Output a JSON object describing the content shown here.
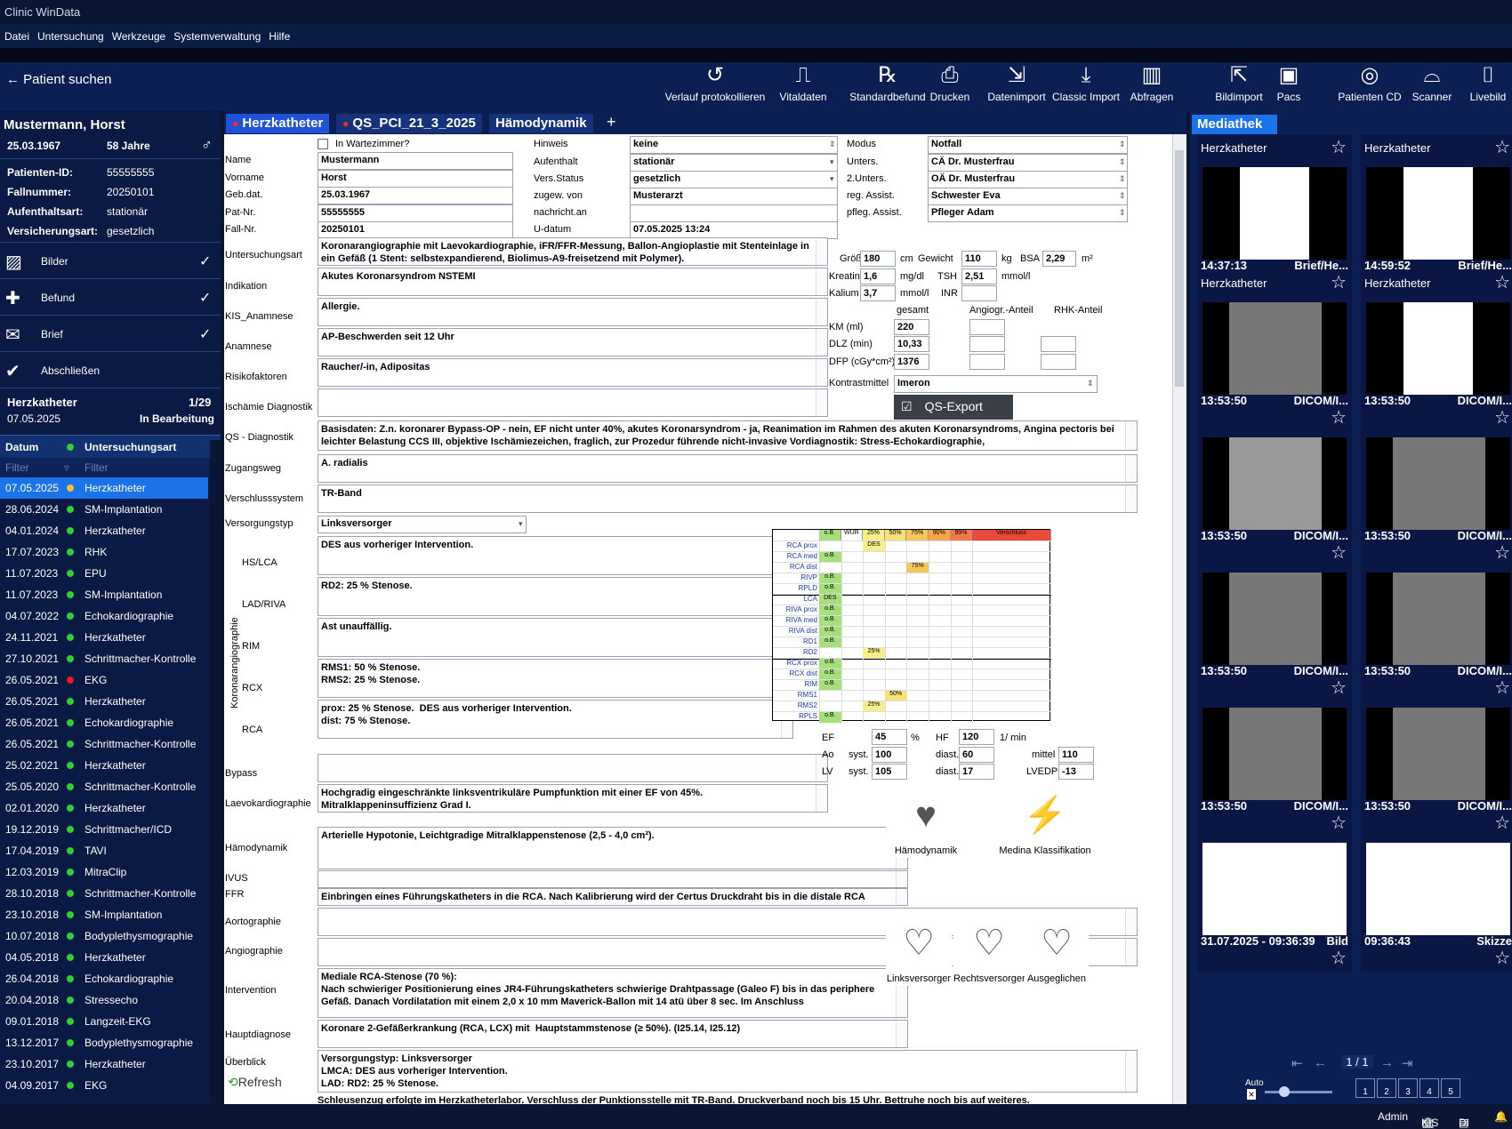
{
  "app": {
    "title": "Clinic WinData"
  },
  "menu": [
    "Datei",
    "Untersuchung",
    "Werkzeuge",
    "Systemverwaltung",
    "Hilfe"
  ],
  "toolbar": {
    "patient_search": "Patient suchen",
    "buttons": [
      "Verlauf protokollieren",
      "Vitaldaten",
      "Standardbefund",
      "Drucken",
      "Datenimport",
      "Classic Import",
      "Abfragen"
    ],
    "right_buttons": [
      "Bildimport",
      "Pacs",
      "Patienten CD",
      "Scanner",
      "Livebild"
    ]
  },
  "patient": {
    "name": "Mustermann, Horst",
    "dob": "25.03.1967",
    "age": "58 Jahre",
    "fields": [
      {
        "k": "Patienten-ID:",
        "v": "55555555"
      },
      {
        "k": "Fallnummer:",
        "v": "20250101"
      },
      {
        "k": "Aufenthaltsart:",
        "v": "stationär"
      },
      {
        "k": "Versicherungsart:",
        "v": "gesetzlich"
      }
    ]
  },
  "steps": [
    {
      "label": "Bilder",
      "icon": "image-icon",
      "done": "✓"
    },
    {
      "label": "Befund",
      "icon": "clipboard-plus-icon",
      "done": "✓"
    },
    {
      "label": "Brief",
      "icon": "envelope-icon",
      "done": "✓"
    },
    {
      "label": "Abschließen",
      "icon": "document-check-icon",
      "done": ""
    }
  ],
  "exam": {
    "name": "Herzkatheter",
    "count": "1/29",
    "date": "07.05.2025",
    "status": "In Bearbeitung"
  },
  "history": {
    "col_date": "Datum",
    "col_type": "Untersuchungsart",
    "filter": "Filter",
    "rows": [
      {
        "d": "07.05.2025",
        "t": "Herzkatheter",
        "c": "#f2c230"
      },
      {
        "d": "28.06.2024",
        "t": "SM-Implantation",
        "c": "#2fd02f"
      },
      {
        "d": "04.01.2024",
        "t": "Herzkatheter",
        "c": "#2fd02f"
      },
      {
        "d": "17.07.2023",
        "t": "RHK",
        "c": "#2fd02f"
      },
      {
        "d": "11.07.2023",
        "t": "EPU",
        "c": "#2fd02f"
      },
      {
        "d": "11.07.2023",
        "t": "SM-Implantation",
        "c": "#2fd02f"
      },
      {
        "d": "04.07.2022",
        "t": "Echokardiographie",
        "c": "#2fd02f"
      },
      {
        "d": "24.11.2021",
        "t": "Herzkatheter",
        "c": "#2fd02f"
      },
      {
        "d": "27.10.2021",
        "t": "Schrittmacher-Kontrolle",
        "c": "#2fd02f"
      },
      {
        "d": "26.05.2021",
        "t": "EKG",
        "c": "#e81c1c"
      },
      {
        "d": "26.05.2021",
        "t": "Herzkatheter",
        "c": "#2fd02f"
      },
      {
        "d": "26.05.2021",
        "t": "Echokardiographie",
        "c": "#2fd02f"
      },
      {
        "d": "26.05.2021",
        "t": "Schrittmacher-Kontrolle",
        "c": "#2fd02f"
      },
      {
        "d": "25.02.2021",
        "t": "Herzkatheter",
        "c": "#2fd02f"
      },
      {
        "d": "25.05.2020",
        "t": "Schrittmacher-Kontrolle",
        "c": "#2fd02f"
      },
      {
        "d": "02.01.2020",
        "t": "Herzkatheter",
        "c": "#2fd02f"
      },
      {
        "d": "19.12.2019",
        "t": "Schrittmacher/ICD",
        "c": "#2fd02f"
      },
      {
        "d": "17.04.2019",
        "t": "TAVI",
        "c": "#2fd02f"
      },
      {
        "d": "12.03.2019",
        "t": "MitraClip",
        "c": "#2fd02f"
      },
      {
        "d": "28.10.2018",
        "t": "Schrittmacher-Kontrolle",
        "c": "#2fd02f"
      },
      {
        "d": "23.10.2018",
        "t": "SM-Implantation",
        "c": "#2fd02f"
      },
      {
        "d": "10.07.2018",
        "t": "Bodyplethysmographie",
        "c": "#2fd02f"
      },
      {
        "d": "04.05.2018",
        "t": "Herzkatheter",
        "c": "#2fd02f"
      },
      {
        "d": "26.04.2018",
        "t": "Echokardiographie",
        "c": "#2fd02f"
      },
      {
        "d": "20.04.2018",
        "t": "Stressecho",
        "c": "#2fd02f"
      },
      {
        "d": "09.01.2018",
        "t": "Langzeit-EKG",
        "c": "#2fd02f"
      },
      {
        "d": "13.12.2017",
        "t": "Bodyplethysmographie",
        "c": "#2fd02f"
      },
      {
        "d": "23.10.2017",
        "t": "Herzkatheter",
        "c": "#2fd02f"
      },
      {
        "d": "04.09.2017",
        "t": "EKG",
        "c": "#2fd02f"
      }
    ]
  },
  "tabs": [
    "Herzkatheter",
    "QS_PCI_21_3_2025",
    "Hämodynamik",
    "+"
  ],
  "form": {
    "wartezimmer": "In Wartezimmer?",
    "name_l": "Name",
    "name": "Mustermann",
    "vorname_l": "Vorname",
    "vorname": "Horst",
    "gebdat_l": "Geb.dat.",
    "gebdat": "25.03.1967",
    "patnr_l": "Pat-Nr.",
    "patnr": "55555555",
    "fallnr_l": "Fall-Nr.",
    "fallnr": "20250101",
    "hinweis_l": "Hinweis",
    "hinweis": "keine",
    "aufenthalt_l": "Aufenthalt",
    "aufenthalt": "stationär",
    "versstatus_l": "Vers.Status",
    "versstatus": "gesetzlich",
    "zugew_l": "zugew. von",
    "zugew": "Musterarzt",
    "nachricht_l": "nachricht.an",
    "nachricht": "",
    "udatum_l": "U-datum",
    "udatum": "07.05.2025 13:24",
    "modus_l": "Modus",
    "modus": "Notfall",
    "unters_l": "Unters.",
    "unters": "CÄ Dr. Musterfrau",
    "unters2_l": "2.Unters.",
    "unters2": "OÄ Dr. Musterfrau",
    "regassist_l": "reg. Assist.",
    "regassist": "Schwester Eva",
    "flegassist_l": "pfleg. Assist.",
    "flegassist": "Pfleger Adam",
    "uart_l": "Untersuchungsart",
    "uart": "Koronarangiographie mit Laevokardiographie, iFR/FFR-Messung, Ballon-Angioplastie mit Stenteinlage in ein Gefäß (1 Stent: selbstexpandierend, Biolimus-A9-freisetzend mit Polymer).",
    "indikation_l": "Indikation",
    "indikation": "Akutes Koronarsyndrom NSTEMI",
    "kis_l": "KIS_Anamnese",
    "kis": "Allergie.",
    "anamnese_l": "Anamnese",
    "anamnese": "AP-Beschwerden seit 12 Uhr",
    "risiko_l": "Risikofaktoren",
    "risiko": "Raucher/-in, Adipositas",
    "ischaemie_l": "Ischämie Diagnostik",
    "ischaemie": "",
    "qsdiag_l": "QS - Diagnostik",
    "qsdiag": "Basisdaten: Z.n. koronarer Bypass-OP - nein, EF nicht unter 40%, akutes Koronarsyndrom - ja, Reanimation im Rahmen des akuten Koronarsyndroms, Angina pectoris bei leichter Belastung CCS III, objektive Ischämiezeichen, fraglich, zur Prozedur führende nicht-invasive Vordiagnostik: Stress-Echokardiographie,",
    "zugang_l": "Zugangsweg",
    "zugang": "A. radialis",
    "verschluss_l": "Verschlusssystem",
    "verschluss": "TR-Band",
    "versorgung_l": "Versorgungstyp",
    "versorgung": "Linksversorger",
    "koro_l": "Koronarangiographie",
    "hslca_l": "HS/LCA",
    "hslca": "DES aus vorheriger Intervention.",
    "lad_l": "LAD/RIVA",
    "lad": "RD2: 25 % Stenose.",
    "rim_l": "RIM",
    "rim": "Ast unauffällig.",
    "rcx_l": "RCX",
    "rcx": "RMS1: 50 % Stenose.\nRMS2: 25 % Stenose.",
    "rca_l": "RCA",
    "rca": "prox: 25 % Stenose.  DES aus vorheriger Intervention.\ndist: 75 % Stenose.",
    "bypass_l": "Bypass",
    "bypass": "",
    "laevo_l": "Laevokardiographie",
    "laevo": "Hochgradig eingeschränkte linksventrikuläre Pumpfunktion mit einer EF von 45%.\nMitralklappeninsuffizienz Grad I.",
    "haemo_l": "Hämodynamik",
    "haemo": "Arterielle Hypotonie, Leichtgradige Mitralklappenstenose (2,5 - 4,0 cm²).",
    "ivus_l": "IVUS",
    "ivus": "",
    "ffr_l": "FFR",
    "ffr": "Einbringen eines Führungskatheters in die RCA. Nach Kalibrierung wird der Certus Druckdraht bis in die distale RCA",
    "aorto_l": "Aortographie",
    "aorto": "",
    "angio_l": "Angiographie",
    "angio": "",
    "interv_l": "Intervention",
    "interv": "Mediale RCA-Stenose (70 %):\nNach schwieriger Positionierung eines JR4-Führungskatheters schwierige Drahtpassage (Galeo F) bis in das periphere Gefäß. Danach Vordilatation mit einem 2,0 x 10 mm Maverick-Ballon mit 14 atü über 8 sec. Im Anschluss",
    "haupt_l": "Hauptdiagnose",
    "haupt": "Koronare 2-Gefäßerkrankung (RCA, LCX) mit  Hauptstammstenose (≥ 50%). (I25.14, I25.12)",
    "ueber_l": "Überblick",
    "ueber": "Versorgungstyp: Linksversorger\nLMCA: DES aus vorheriger Intervention.\nLAD: RD2: 25 % Stenose.",
    "ueber_tail": "Schleusenzug erfolgte im Herzkatheterlabor. Verschluss der Punktionsstelle mit TR-Band. Druckverband noch bis 15 Uhr. Bettruhe noch bis auf weiteres.",
    "refresh": "Refresh",
    "groesse_l": "Größe",
    "groesse": "180",
    "groesse_u": "cm",
    "gewicht_l": "Gewicht",
    "gewicht": "110",
    "gewicht_u": "kg",
    "bsa_l": "BSA",
    "bsa": "2,29",
    "bsa_u": "m²",
    "kreatinin_l": "Kreatinin",
    "kreatinin": "1,6",
    "kreatinin_u": "mg/dl",
    "tsh_l": "TSH",
    "tsh": "2,51",
    "tsh_u": "mmol/l",
    "kalium_l": "Kalium",
    "kalium": "3,7",
    "kalium_u": "mmol/l",
    "inr_l": "INR",
    "inr": "",
    "gesamt_l": "gesamt",
    "angiogr_l": "Angiogr.-Anteil",
    "rhk_l": "RHK-Anteil",
    "km_l": "KM (ml)",
    "km": "220",
    "dlz_l": "DLZ (min)",
    "dlz": "10,33",
    "dfp_l": "DFP (cGy*cm²)",
    "dfp": "1376",
    "kontrast_l": "Kontrastmittel",
    "kontrast": "Imeron",
    "qsexport": "QS-Export",
    "ef_l": "EF",
    "ef": "45",
    "ef_u": "%",
    "hf_l": "HF",
    "hf": "120",
    "hf_u": "1/ min",
    "ao_l": "Ao",
    "syst_l": "syst.",
    "ao_syst": "100",
    "diast_l": "diast.",
    "ao_diast": "60",
    "mittel_l": "mittel",
    "ao_mittel": "110",
    "lv_l": "LV",
    "lv_syst": "105",
    "lv_diast": "17",
    "lvedp_l": "LVEDP",
    "lvedp": "-13",
    "img_haemo": "Hämodynamik",
    "img_medina": "Medina Klassifikation",
    "img_links": "Linksversorger",
    "img_rechts": "Rechtsversorger",
    "img_ausg": "Ausgeglichen"
  },
  "stenosis": {
    "columns": [
      "o.B.",
      "WUR",
      "25%",
      "50%",
      "75%",
      "90%",
      "99%",
      "Verschluss"
    ],
    "column_colors": [
      "#a6e07a",
      "#ffffff",
      "#f7f08a",
      "#f7e27a",
      "#f5c65a",
      "#f5a64a",
      "#f07a4a",
      "#e84a3a"
    ],
    "groups": [
      {
        "rows": [
          {
            "name": "RCA prox",
            "mark": 2,
            "text": "DES"
          },
          {
            "name": "RCA med",
            "mark": 0,
            "text": "o.B."
          },
          {
            "name": "RCA dist",
            "mark": 4,
            "text": "75%"
          },
          {
            "name": "RIVP",
            "mark": 0,
            "text": "o.B."
          },
          {
            "name": "RPLD",
            "mark": 0,
            "text": "o.B."
          }
        ]
      },
      {
        "rows": [
          {
            "name": "LCA",
            "mark": 0,
            "text": "DES"
          },
          {
            "name": "RIVA prox",
            "mark": 0,
            "text": "o.B."
          },
          {
            "name": "RIVA med",
            "mark": 0,
            "text": "o.B."
          },
          {
            "name": "RIVA dist",
            "mark": 0,
            "text": "o.B."
          },
          {
            "name": "RD1",
            "mark": 0,
            "text": "o.B."
          },
          {
            "name": "RD2",
            "mark": 2,
            "text": "25%"
          }
        ]
      },
      {
        "rows": [
          {
            "name": "RCX prox",
            "mark": 0,
            "text": "o.B."
          },
          {
            "name": "RCX dist",
            "mark": 0,
            "text": "o.B."
          },
          {
            "name": "RIM",
            "mark": 0,
            "text": "o.B."
          },
          {
            "name": "RMS1",
            "mark": 3,
            "text": "50%"
          },
          {
            "name": "RMS2",
            "mark": 2,
            "text": "25%"
          },
          {
            "name": "RPLS",
            "mark": 0,
            "text": "o.B."
          }
        ]
      }
    ]
  },
  "media": {
    "tab": "Mediathek",
    "items": [
      {
        "time": "",
        "kind": "",
        "sub": "Herzkatheter",
        "img": "white"
      },
      {
        "time": "",
        "kind": "",
        "sub": "Herzkatheter",
        "img": "white"
      },
      {
        "time": "14:37:13",
        "kind": "Brief/He...",
        "sub": "Herzkatheter",
        "img": "doc"
      },
      {
        "time": "14:59:52",
        "kind": "Brief/He...",
        "sub": "Herzkatheter",
        "img": "doc"
      },
      {
        "time": "13:53:50",
        "kind": "DICOM/I...",
        "sub": "",
        "img": "xray"
      },
      {
        "time": "13:53:50",
        "kind": "DICOM/I...",
        "sub": "",
        "img": "doc"
      },
      {
        "time": "13:53:50",
        "kind": "DICOM/I...",
        "sub": "",
        "img": "test"
      },
      {
        "time": "13:53:50",
        "kind": "DICOM/I...",
        "sub": "",
        "img": "xray"
      },
      {
        "time": "13:53:50",
        "kind": "DICOM/I...",
        "sub": "",
        "img": "xray"
      },
      {
        "time": "13:53:50",
        "kind": "DICOM/I...",
        "sub": "",
        "img": "xray"
      },
      {
        "time": "13:53:50",
        "kind": "DICOM/I...",
        "sub": "",
        "img": "xray"
      },
      {
        "time": "13:53:50",
        "kind": "DICOM/I...",
        "sub": "",
        "img": "xray"
      },
      {
        "time": "31.07.2025 - 09:36:39",
        "kind": "Bild",
        "sub": "",
        "img": "table"
      },
      {
        "time": "09:36:43",
        "kind": "Skizze",
        "sub": "",
        "img": "sketch"
      }
    ],
    "pager": "1 / 1",
    "auto": "Auto",
    "layouts": [
      "1",
      "2",
      "3",
      "4",
      "5"
    ]
  },
  "status": {
    "user": "Admin",
    "kis": "KIS",
    "di": "DI"
  }
}
